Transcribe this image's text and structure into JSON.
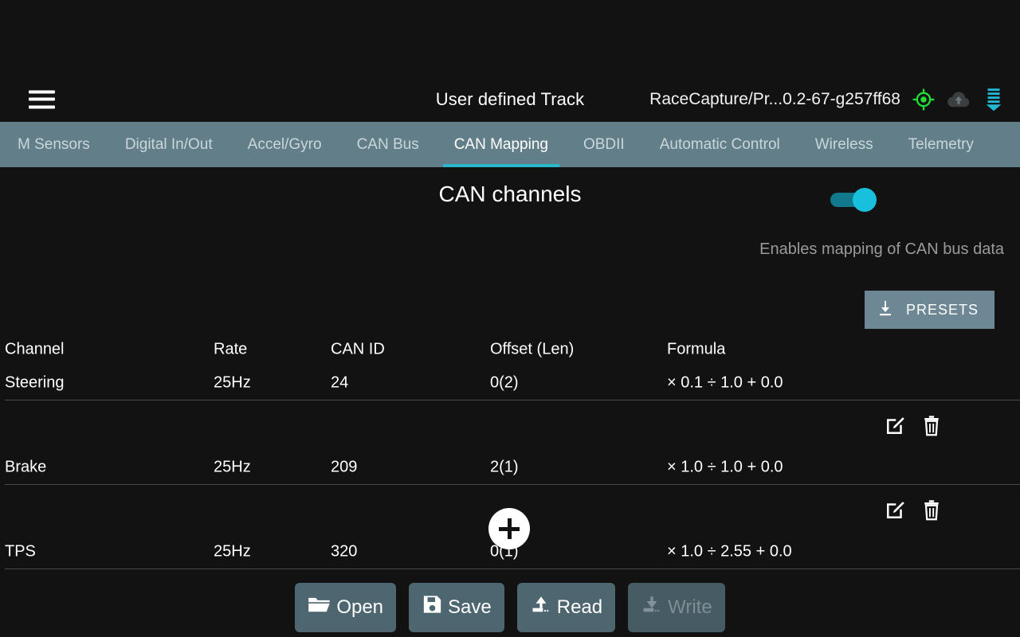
{
  "appbar": {
    "menu_icon": "hamburger-menu-icon",
    "title": "User defined Track",
    "version": "RaceCapture/Pr...0.2-67-g257ff68",
    "icons": [
      {
        "name": "gps-target-icon",
        "color": "#22dd33"
      },
      {
        "name": "cloud-upload-icon",
        "color": "#3a3f42"
      },
      {
        "name": "download-progress-icon",
        "color": "#22b8d6"
      }
    ]
  },
  "tabs": [
    {
      "label": "M Sensors",
      "active": false
    },
    {
      "label": "Digital In/Out",
      "active": false
    },
    {
      "label": "Accel/Gyro",
      "active": false
    },
    {
      "label": "CAN Bus",
      "active": false
    },
    {
      "label": "CAN Mapping",
      "active": true
    },
    {
      "label": "OBDII",
      "active": false
    },
    {
      "label": "Automatic Control",
      "active": false
    },
    {
      "label": "Wireless",
      "active": false
    },
    {
      "label": "Telemetry",
      "active": false
    }
  ],
  "section": {
    "title": "CAN channels",
    "toggle_on": true,
    "subtitle": "Enables mapping of CAN bus data",
    "presets_label": "PRESETS",
    "presets_icon": "download-icon",
    "accent_color": "#2ab7ca",
    "tabbar_color": "#627f89"
  },
  "table": {
    "columns": [
      "Channel",
      "Rate",
      "CAN ID",
      "Offset (Len)",
      "Formula"
    ],
    "rows": [
      {
        "channel": "Steering",
        "rate": "25Hz",
        "can_id": "24",
        "offset": "0(2)",
        "formula": "× 0.1 ÷ 1.0 + 0.0"
      },
      {
        "channel": "Brake",
        "rate": "25Hz",
        "can_id": "209",
        "offset": "2(1)",
        "formula": "× 1.0 ÷ 1.0 + 0.0"
      },
      {
        "channel": "TPS",
        "rate": "25Hz",
        "can_id": "320",
        "offset": "0(1)",
        "formula": "× 1.0 ÷ 2.55 + 0.0"
      }
    ],
    "row_actions": {
      "edit_icon": "edit-icon",
      "delete_icon": "trash-icon"
    }
  },
  "fab": {
    "name": "add-channel-button",
    "icon": "plus-icon"
  },
  "bottom_buttons": [
    {
      "label": "Open",
      "icon": "folder-open-icon",
      "enabled": true
    },
    {
      "label": "Save",
      "icon": "floppy-disk-icon",
      "enabled": true
    },
    {
      "label": "Read",
      "icon": "upload-arrow-icon",
      "enabled": true
    },
    {
      "label": "Write",
      "icon": "download-arrow-icon",
      "enabled": false
    }
  ]
}
